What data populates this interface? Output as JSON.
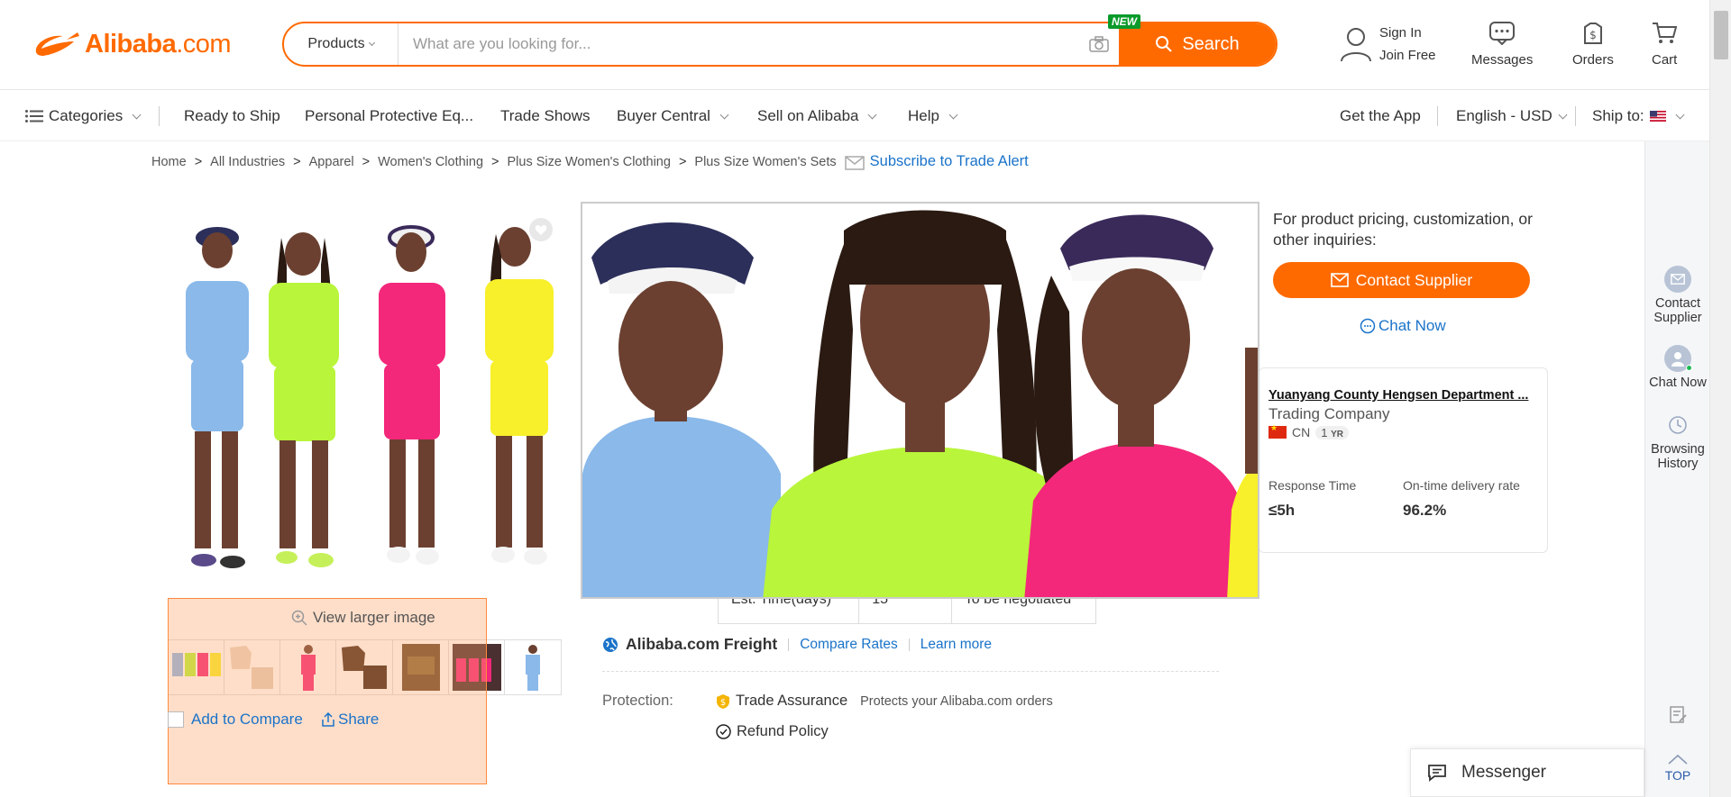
{
  "header": {
    "logo_text": "Alibaba",
    "logo_suffix": ".com",
    "search": {
      "category": "Products",
      "placeholder": "What are you looking for...",
      "new_badge": "NEW",
      "button_label": "Search"
    },
    "sign_in": "Sign In",
    "join_free": "Join Free",
    "messages": "Messages",
    "orders": "Orders",
    "cart": "Cart"
  },
  "nav": {
    "categories": "Categories",
    "items": [
      "Ready to Ship",
      "Personal Protective Eq...",
      "Trade Shows",
      "Buyer Central",
      "Sell on Alibaba",
      "Help"
    ],
    "get_app": "Get the App",
    "language": "English - USD",
    "ship_to": "Ship to:"
  },
  "breadcrumb": {
    "items": [
      "Home",
      "All Industries",
      "Apparel",
      "Women's Clothing",
      "Plus Size Women's Clothing",
      "Plus Size Women's Sets"
    ],
    "separator": ">",
    "subscribe": "Subscribe to Trade Alert"
  },
  "gallery": {
    "view_larger": "View larger image",
    "add_to_compare": "Add to Compare",
    "share": "Share"
  },
  "shipping": {
    "est_label": "Est. Time(days)",
    "est_value": "15",
    "est_negotiated": "To be negotiated",
    "freight_brand": "Alibaba.com Freight",
    "compare_rates": "Compare Rates",
    "learn_more": "Learn more"
  },
  "protection": {
    "label": "Protection:",
    "trade_assurance": "Trade Assurance",
    "trade_assurance_desc": "Protects your Alibaba.com orders",
    "refund_policy": "Refund Policy"
  },
  "inquiry": {
    "text": "For product pricing, customization, or other inquiries:",
    "contact_button": "Contact Supplier",
    "chat_now": "Chat Now"
  },
  "supplier": {
    "name": "Yuanyang County Hengsen Department ...",
    "type": "Trading Company",
    "country": "CN",
    "years": "1",
    "years_unit": "YR",
    "response_time_label": "Response Time",
    "response_time_value": "≤5h",
    "ontime_label": "On-time delivery rate",
    "ontime_value": "96.2%"
  },
  "sidebar": {
    "contact_supplier": "Contact Supplier",
    "chat_now": "Chat Now",
    "browsing_history": "Browsing History",
    "top": "TOP"
  },
  "messenger": "Messenger",
  "colors": {
    "brand": "#ff6a00",
    "link": "#1a73c9",
    "shirt_blue": "#8ab9ea",
    "shirt_green": "#b9f53a",
    "shirt_pink": "#f3287a",
    "shirt_yellow": "#f7f02a"
  }
}
